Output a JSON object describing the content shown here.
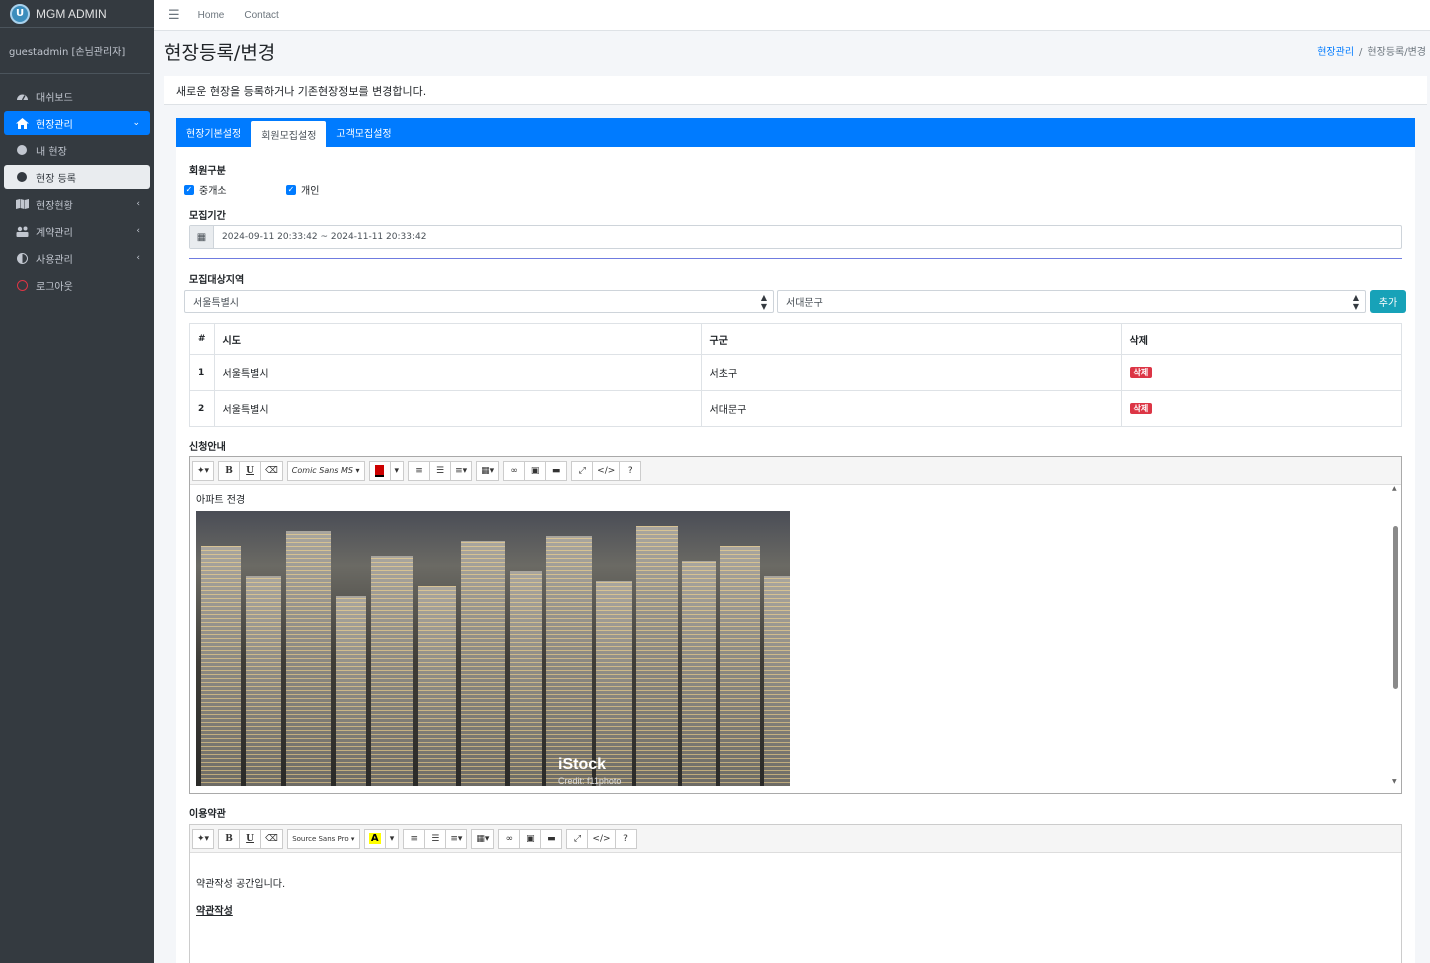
{
  "brand": {
    "logo_letter": "U",
    "name": "MGM ADMIN"
  },
  "user": {
    "name": "guestadmin [손님관리자]"
  },
  "sidebar": {
    "items": [
      {
        "label": "대쉬보드",
        "icon": "dashboard-icon"
      },
      {
        "label": "현장관리",
        "icon": "home-icon"
      },
      {
        "label": "내 현장",
        "icon": "circle-icon"
      },
      {
        "label": "현장 등록",
        "icon": "circle-icon"
      },
      {
        "label": "현장현황",
        "icon": "map-icon"
      },
      {
        "label": "계약관리",
        "icon": "people-icon"
      },
      {
        "label": "사용관리",
        "icon": "adjust-icon"
      },
      {
        "label": "로그아웃",
        "icon": "logout-circle-icon"
      }
    ]
  },
  "topbar": {
    "home": "Home",
    "contact": "Contact"
  },
  "page": {
    "title": "현장등록/변경",
    "breadcrumb_parent": "현장관리",
    "breadcrumb_sep": "/",
    "breadcrumb_current": "현장등록/변경",
    "description": "새로운 현장을 등록하거나 기존현장정보를 변경합니다."
  },
  "tabs": [
    "현장기본설정",
    "회원모집설정",
    "고객모집설정"
  ],
  "form": {
    "member_type_label": "회원구분",
    "member_types": [
      {
        "label": "중개소",
        "checked": true
      },
      {
        "label": "개인",
        "checked": true
      }
    ],
    "period_label": "모집기간",
    "period_value": "2024-09-11 20:33:42 ~ 2024-11-11 20:33:42",
    "region_label": "모집대상지역",
    "sido_selected": "서울특별시",
    "gugun_selected": "서대문구",
    "add_button": "추가",
    "region_table": {
      "headers": [
        "#",
        "시도",
        "구군",
        "삭제"
      ],
      "rows": [
        {
          "num": "1",
          "sido": "서울특별시",
          "gugun": "서초구",
          "del": "삭제"
        },
        {
          "num": "2",
          "sido": "서울특별시",
          "gugun": "서대문구",
          "del": "삭제"
        }
      ]
    },
    "guide_label": "신청안내",
    "guide_editor": {
      "font": "Comic Sans MS",
      "text": "아파트 전경",
      "watermark": "iStock",
      "watermark_credit": "Credit: f11photo"
    },
    "terms_label": "이용약관",
    "terms_editor": {
      "font": "Source Sans Pro",
      "text1": "약관작성 공간입니다.",
      "text2": "약관작성"
    }
  }
}
